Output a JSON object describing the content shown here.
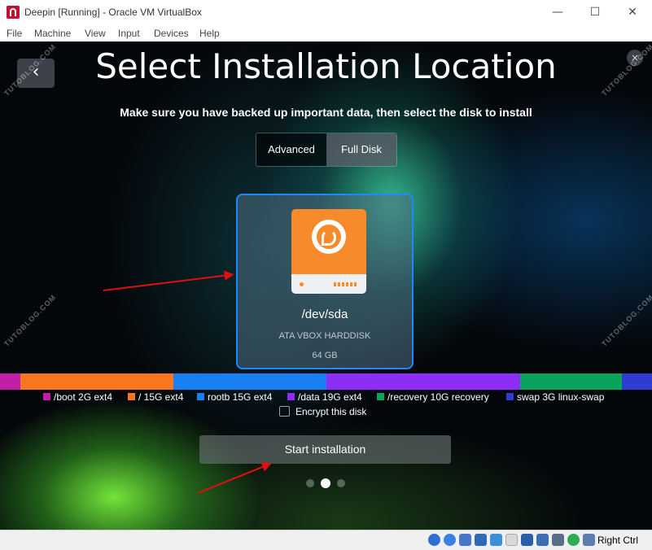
{
  "window": {
    "title": "Deepin [Running] - Oracle VM VirtualBox",
    "minimize_glyph": "—",
    "maximize_glyph": "☐",
    "close_glyph": "✕"
  },
  "menu": [
    "File",
    "Machine",
    "View",
    "Input",
    "Devices",
    "Help"
  ],
  "installer": {
    "back_glyph": "‹",
    "close_glyph": "×",
    "title": "Select Installation Location",
    "subtitle": "Make sure you have backed up important data, then select the disk to install",
    "mode_tabs": {
      "advanced": "Advanced",
      "full_disk": "Full Disk",
      "selected": "Full Disk"
    },
    "disk": {
      "name": "/dev/sda",
      "model": "ATA VBOX HARDDISK",
      "size": "64 GB"
    },
    "partitions": [
      {
        "label": "/boot 2G ext4",
        "color": "#c11fa8",
        "size_gb": 2
      },
      {
        "label": "/ 15G ext4",
        "color": "#f7761e",
        "size_gb": 15
      },
      {
        "label": "rootb 15G ext4",
        "color": "#1880f2",
        "size_gb": 15
      },
      {
        "label": "/data 19G ext4",
        "color": "#8c2ef8",
        "size_gb": 19
      },
      {
        "label": "/recovery 10G recovery",
        "color": "#0aa35b",
        "size_gb": 10
      },
      {
        "label": "swap 3G linux-swap",
        "color": "#2f3cd0",
        "size_gb": 3
      }
    ],
    "encrypt_label": "Encrypt this disk",
    "encrypt_checked": false,
    "start_button": "Start installation",
    "page_indicator": {
      "total": 3,
      "current": 2
    }
  },
  "watermark_text": "TUTOBLOG.COM",
  "statusbar": {
    "host_key": "Right Ctrl"
  },
  "colors": {
    "selection_border": "#1e88ff",
    "accent_orange": "#f78a2a",
    "annotation_arrow": "#e01010"
  }
}
